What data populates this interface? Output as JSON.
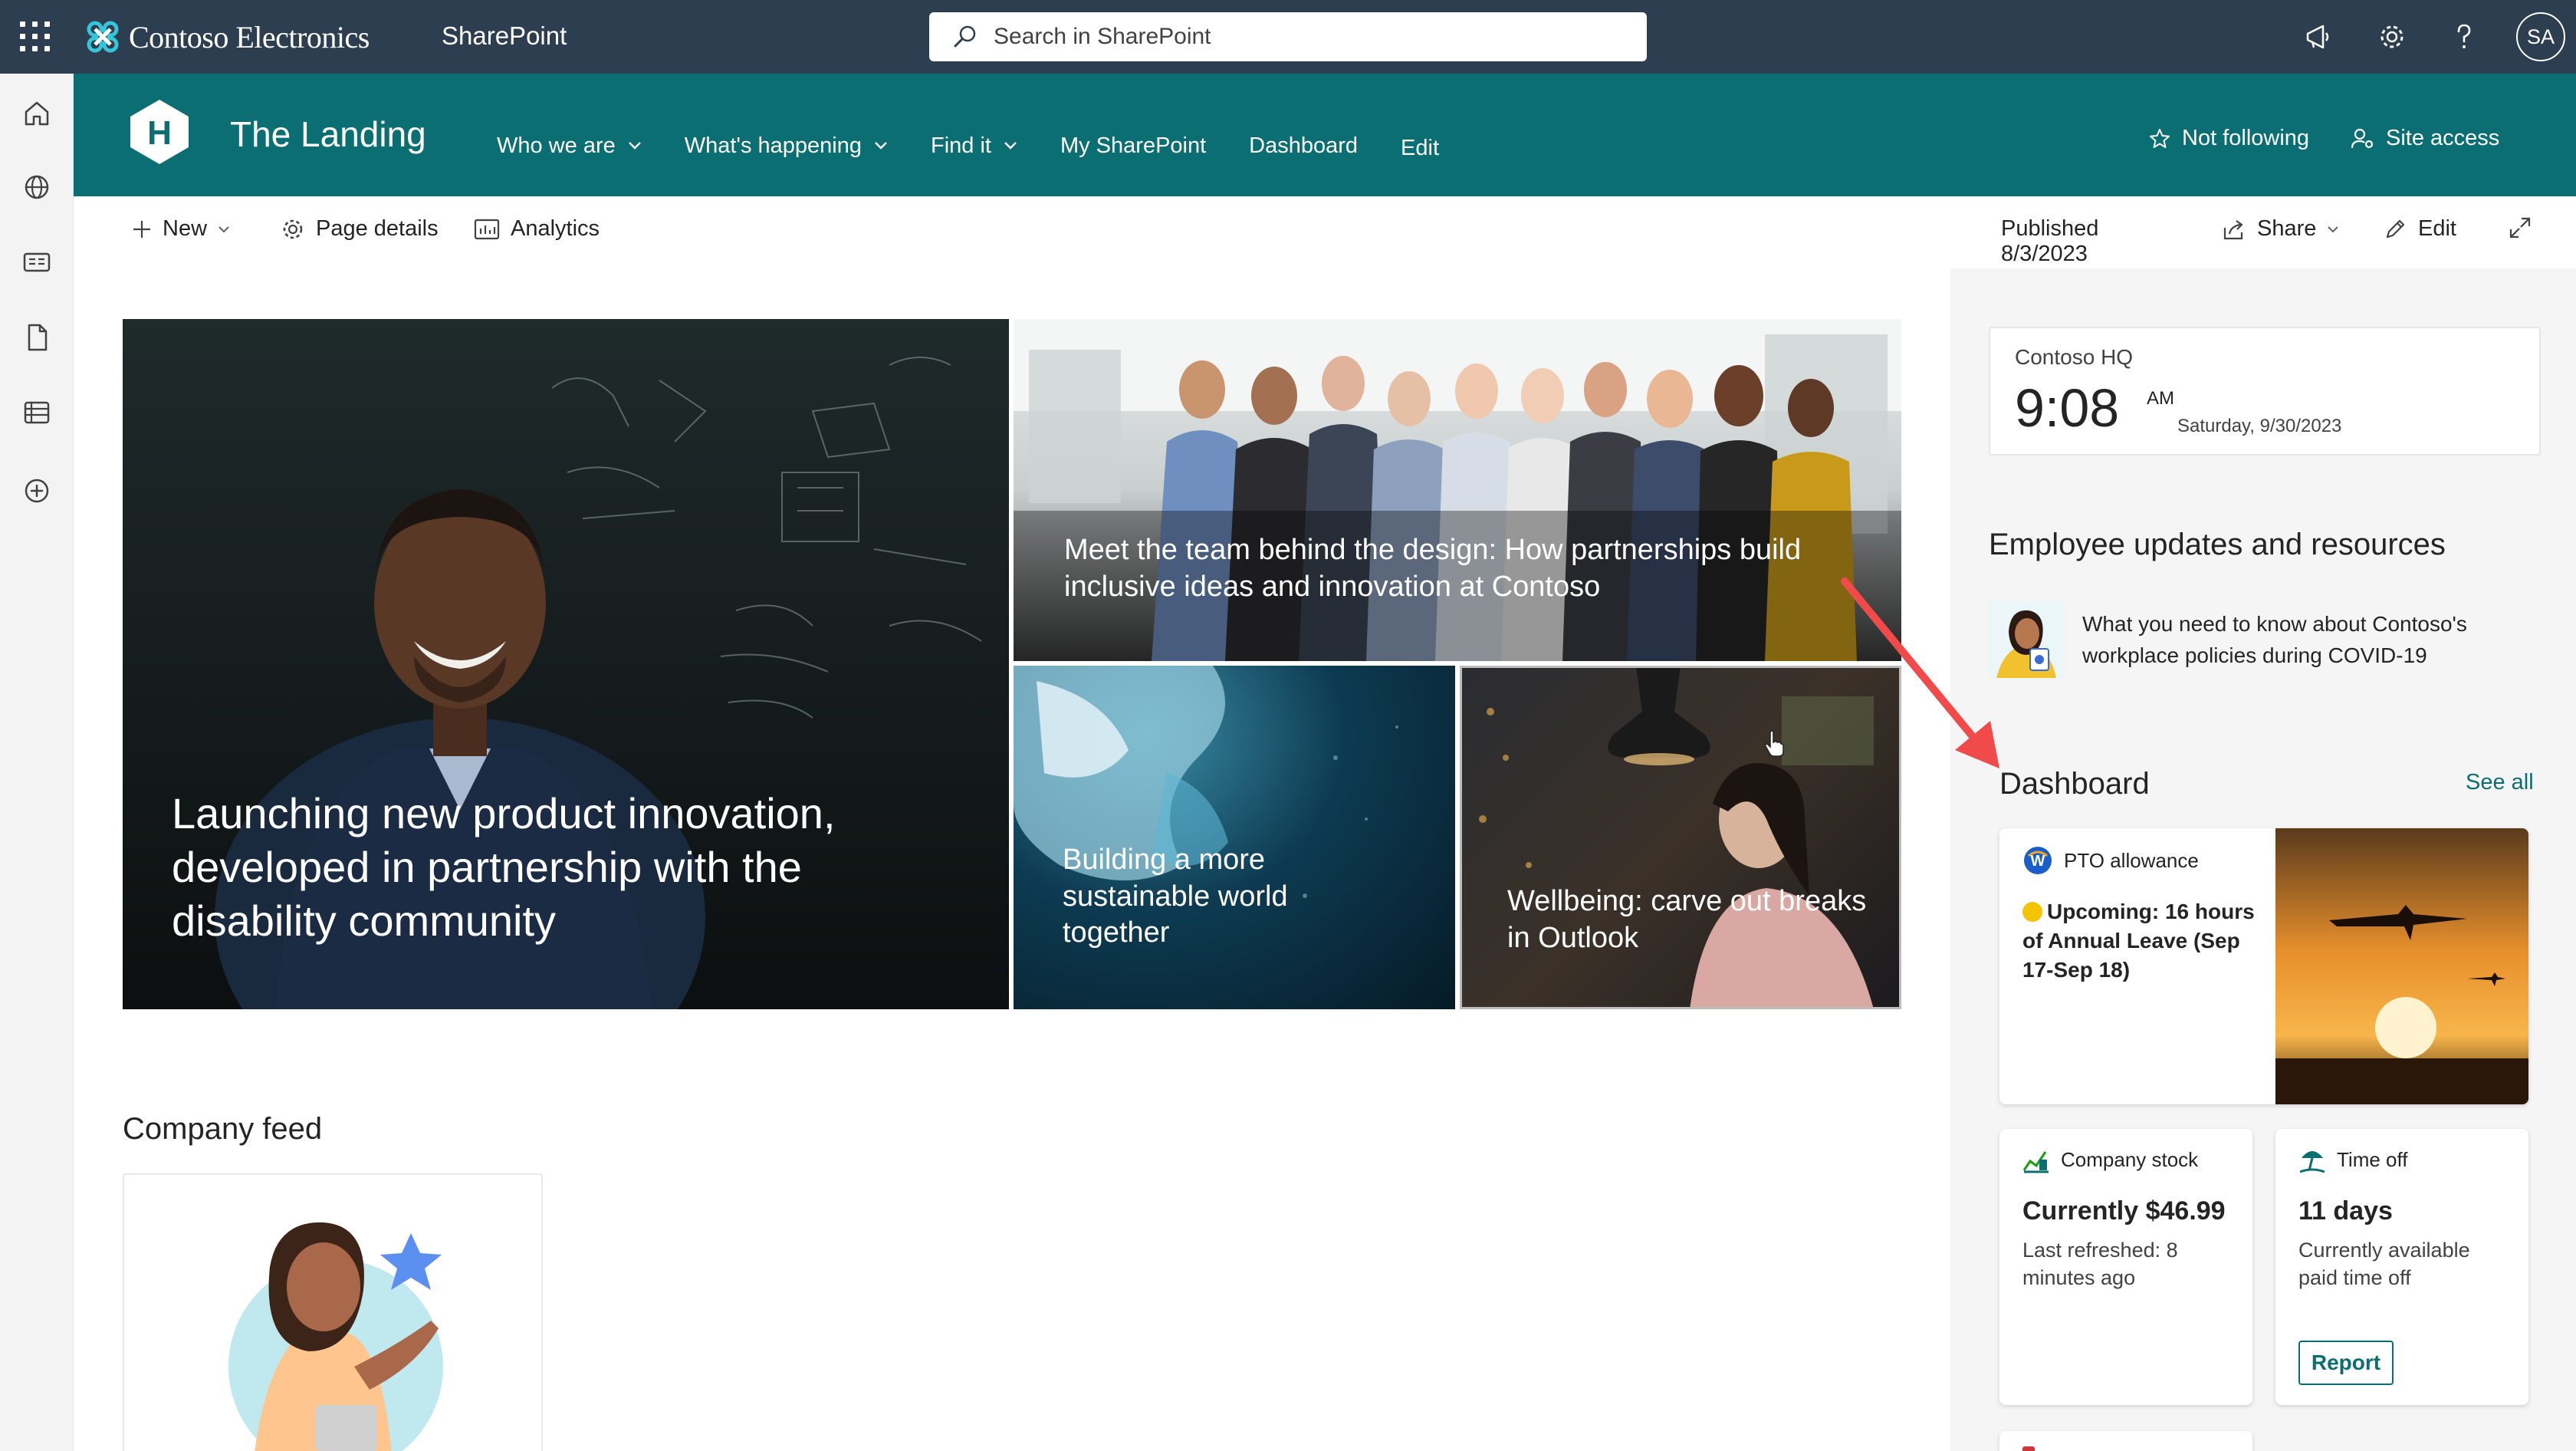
{
  "suite": {
    "brand": "Contoso Electronics",
    "app": "SharePoint",
    "search_placeholder": "Search in SharePoint",
    "avatar_initials": "SA"
  },
  "site": {
    "logo_letter": "H",
    "title": "The Landing",
    "nav": [
      {
        "label": "Who we are",
        "dropdown": true
      },
      {
        "label": "What's happening",
        "dropdown": true
      },
      {
        "label": "Find it",
        "dropdown": true
      },
      {
        "label": "My SharePoint",
        "dropdown": false
      },
      {
        "label": "Dashboard",
        "dropdown": false
      },
      {
        "label": "Edit",
        "dropdown": false
      }
    ],
    "follow_label": "Not following",
    "access_label": "Site access"
  },
  "command_bar": {
    "new_label": "New",
    "page_details_label": "Page details",
    "analytics_label": "Analytics",
    "published_label": "Published 8/3/2023",
    "share_label": "Share",
    "edit_label": "Edit"
  },
  "hero": {
    "main": "Launching new product innovation, developed in partnership with the disability community",
    "top_right": "Meet the team behind the design: How partnerships build inclusive ideas and innovation at Contoso",
    "bottom_left": "Building a more sustainable world together",
    "bottom_right": "Wellbeing: carve out breaks in Outlook"
  },
  "company_feed": {
    "title": "Company feed"
  },
  "clock": {
    "location": "Contoso HQ",
    "time": "9:08",
    "ampm": "AM",
    "date": "Saturday, 9/30/2023"
  },
  "employee_updates": {
    "title": "Employee updates and resources",
    "item_text": "What you need to know about Contoso's workplace policies during COVID-19"
  },
  "dashboard": {
    "title": "Dashboard",
    "see_all": "See all",
    "pto": {
      "label": "PTO allowance",
      "text": "Upcoming: 16 hours of Annual Leave (Sep 17-Sep 18)"
    },
    "stock": {
      "label": "Company stock",
      "value": "Currently $46.99",
      "sub": "Last refreshed: 8 minutes ago"
    },
    "timeoff": {
      "label": "Time off",
      "value": "11 days",
      "sub": "Currently available paid time off",
      "button": "Report"
    }
  },
  "colors": {
    "suite_bar": "#2c3e50",
    "site_header": "#0a6e73",
    "accent": "#0a6e73",
    "annotation_arrow": "#f04a4a"
  }
}
